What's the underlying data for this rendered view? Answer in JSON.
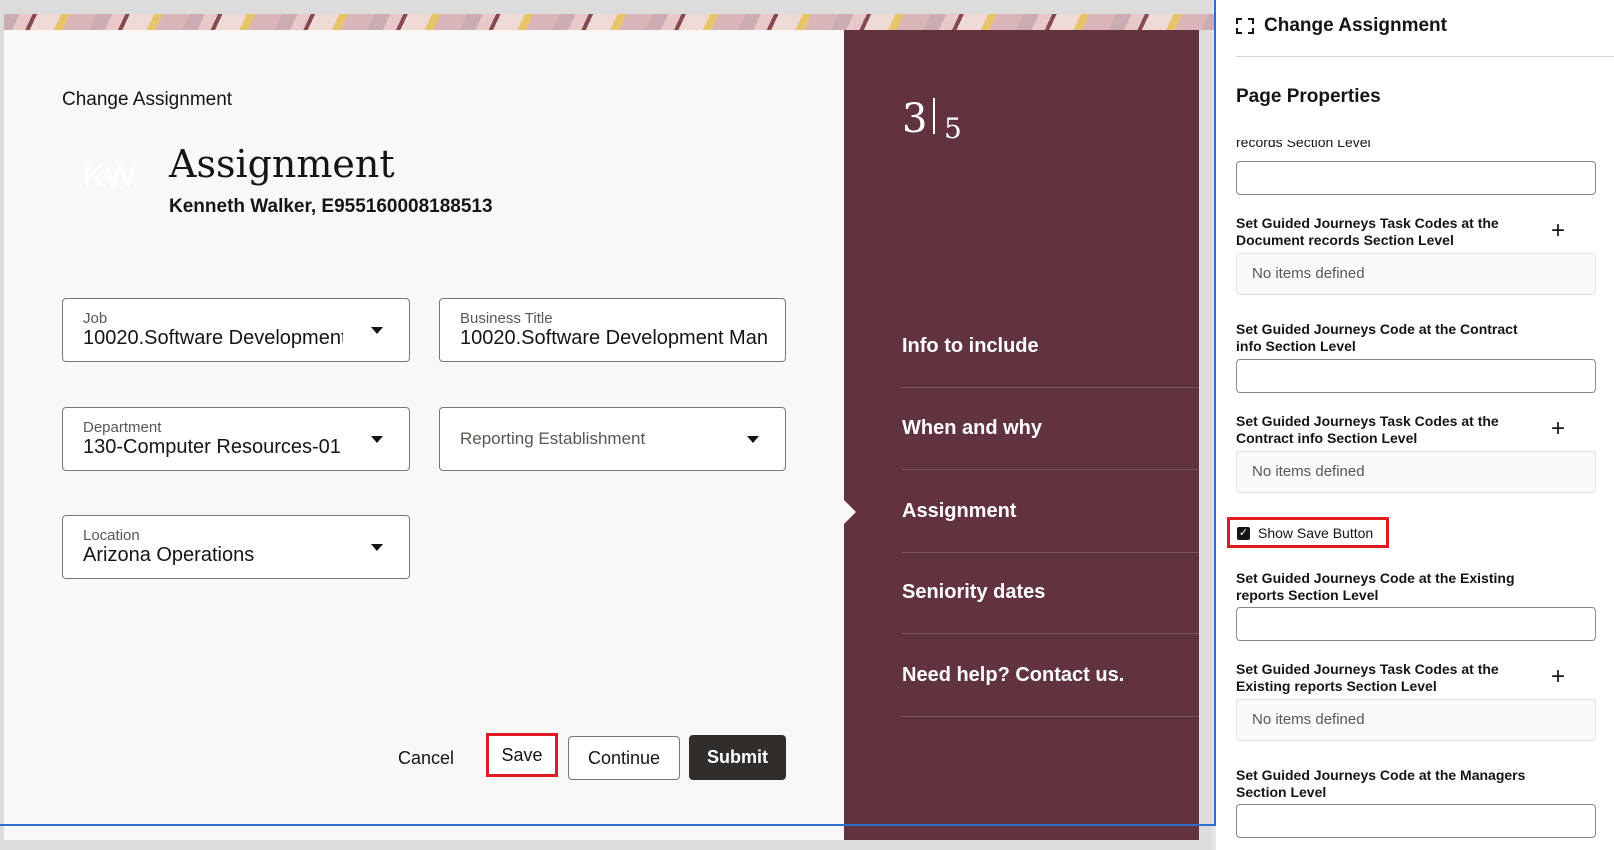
{
  "form": {
    "page_title": "Change Assignment",
    "avatar_initials": "KW",
    "heading": "Assignment",
    "person": "Kenneth Walker, E955160008188513",
    "fields": {
      "job": {
        "label": "Job",
        "value": "10020.Software Development"
      },
      "business_title": {
        "label": "Business Title",
        "value": "10020.Software Development Man"
      },
      "department": {
        "label": "Department",
        "value": "130-Computer Resources-01"
      },
      "reporting_establishment": {
        "placeholder": "Reporting Establishment"
      },
      "location": {
        "label": "Location",
        "value": "Arizona Operations"
      }
    },
    "buttons": {
      "cancel": "Cancel",
      "save": "Save",
      "continue": "Continue",
      "submit": "Submit"
    }
  },
  "steps": {
    "current": "3",
    "total": "5",
    "items": [
      "Info to include",
      "When and why",
      "Assignment",
      "Seniority dates",
      "Need help? Contact us."
    ],
    "active": "Assignment"
  },
  "properties": {
    "title": "Change Assignment",
    "section": "Page Properties",
    "cut_label": "records Section Level",
    "doc_task_label": "Set Guided Journeys Task Codes at the Document records Section Level",
    "empty_text": "No items defined",
    "contract_code_label": "Set Guided Journeys Code at the Contract info Section Level",
    "contract_task_label": "Set Guided Journeys Task Codes at the Contract info Section Level",
    "show_save_label": "Show Save Button",
    "show_save_checked": true,
    "existing_code_label": "Set Guided Journeys Code at the Existing reports Section Level",
    "existing_task_label": "Set Guided Journeys Task Codes at the Existing reports Section Level",
    "managers_code_label": "Set Guided Journeys Code at the Managers Section Level"
  },
  "colors": {
    "panel": "#60333e",
    "highlight": "#e01b24",
    "submit": "#312d2a"
  }
}
